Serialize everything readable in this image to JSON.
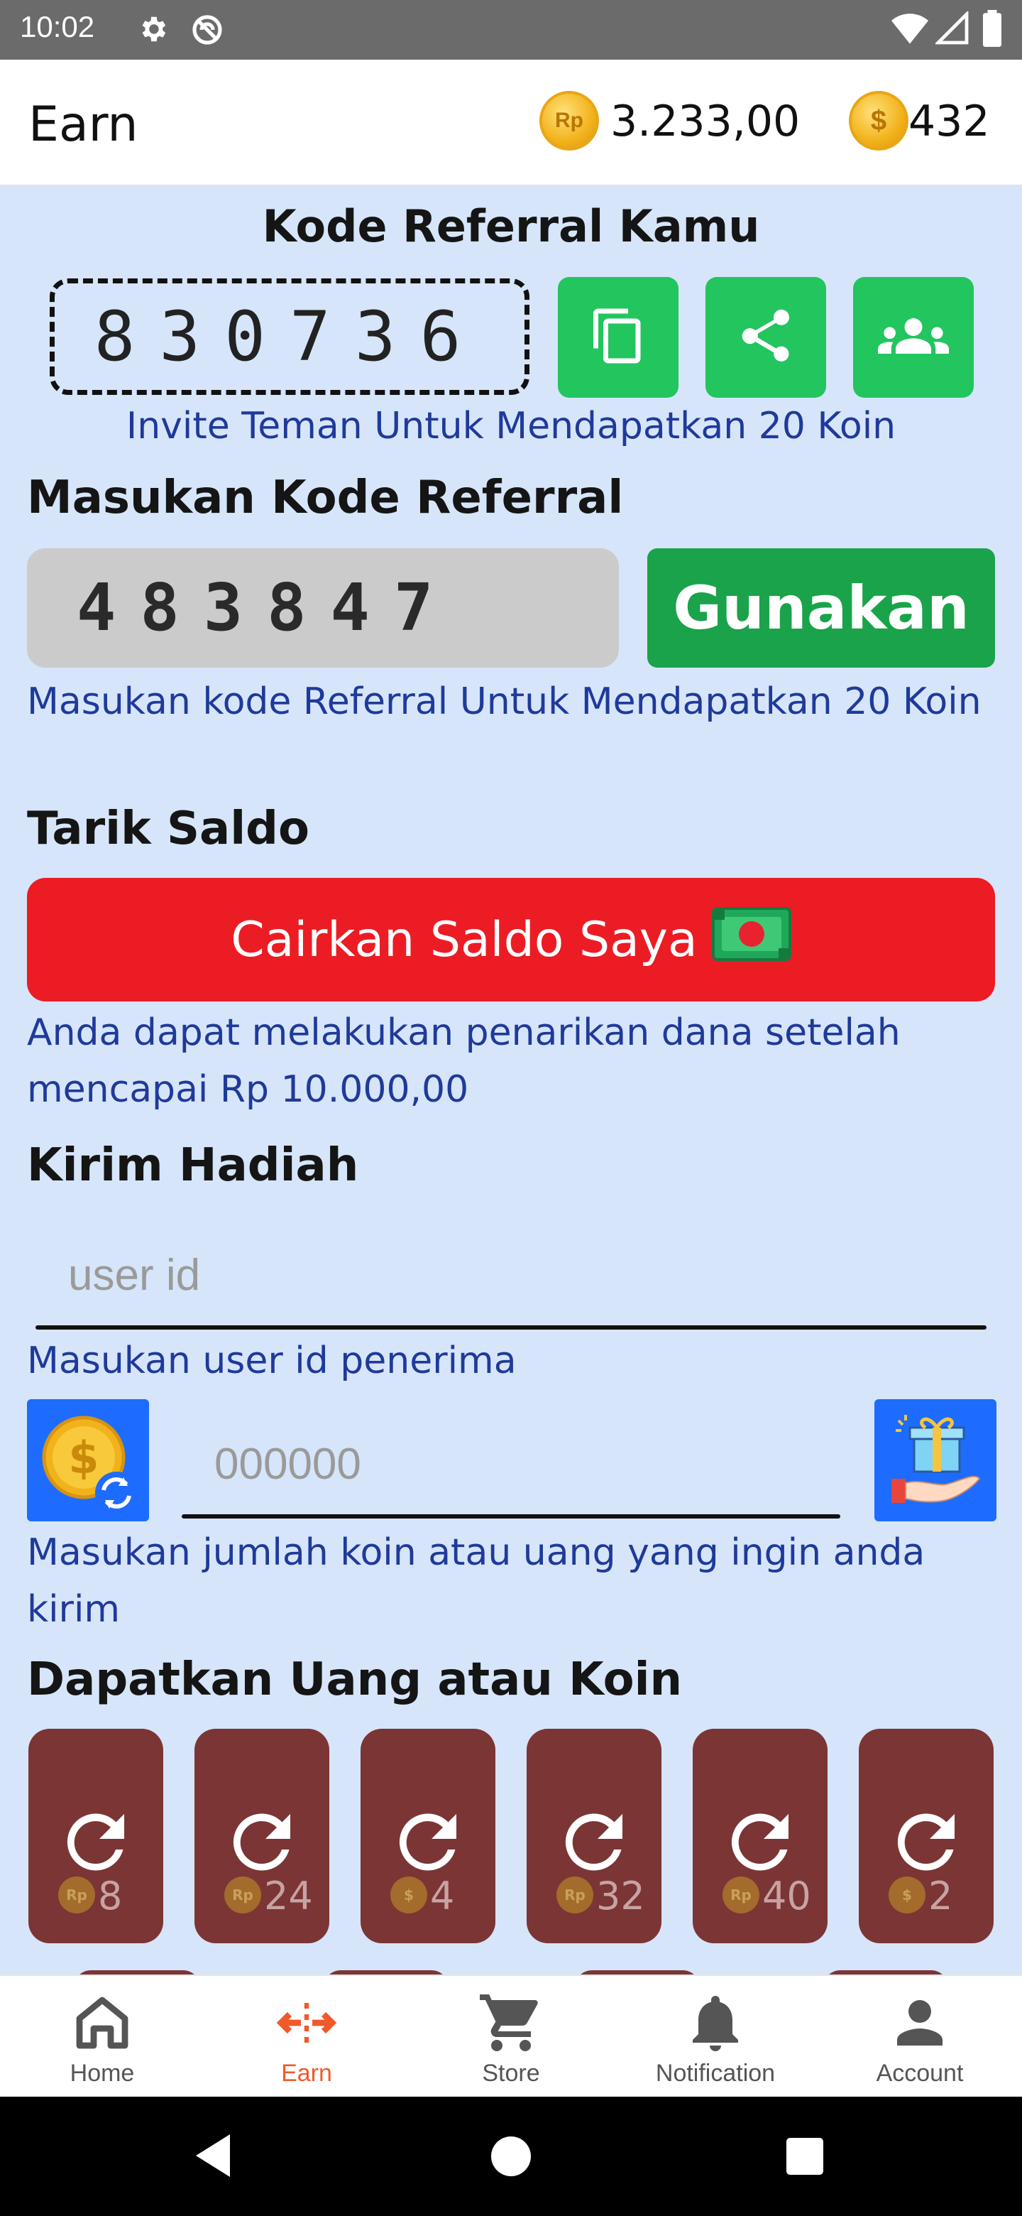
{
  "status_bar": {
    "time": "10:02"
  },
  "app_bar": {
    "title": "Earn",
    "rp_coin_label": "Rp",
    "money_balance": "3.233,00",
    "coin_label": "$",
    "coin_balance": "432"
  },
  "referral": {
    "heading": "Kode Referral Kamu",
    "my_code": "830736",
    "invite_hint": "Invite Teman Untuk Mendapatkan 20 Koin",
    "enter_heading": "Masukan Kode Referral",
    "entered_code": "483847",
    "use_button": "Gunakan",
    "enter_hint": "Masukan kode Referral Untuk Mendapatkan 20 Koin"
  },
  "withdraw": {
    "heading": "Tarik Saldo",
    "button": "Cairkan Saldo Saya",
    "hint": "Anda dapat melakukan penarikan dana setelah mencapai Rp 10.000,00"
  },
  "gift": {
    "heading": "Kirim Hadiah",
    "user_id_placeholder": "user id",
    "user_id_hint": "Masukan user id penerima",
    "amount_placeholder": "000000",
    "amount_hint": "Masukan jumlah koin atau uang yang ingin anda kirim"
  },
  "earn": {
    "heading": "Dapatkan Uang atau Koin",
    "tiles": [
      {
        "currency": "Rp",
        "value": "8"
      },
      {
        "currency": "Rp",
        "value": "24"
      },
      {
        "currency": "$",
        "value": "4"
      },
      {
        "currency": "Rp",
        "value": "32"
      },
      {
        "currency": "Rp",
        "value": "40"
      },
      {
        "currency": "$",
        "value": "2"
      }
    ]
  },
  "bottom_nav": {
    "items": [
      {
        "label": "Home",
        "icon": "home-icon"
      },
      {
        "label": "Earn",
        "icon": "earn-icon",
        "active": true
      },
      {
        "label": "Store",
        "icon": "cart-icon"
      },
      {
        "label": "Notification",
        "icon": "bell-icon"
      },
      {
        "label": "Account",
        "icon": "person-icon"
      }
    ]
  },
  "colors": {
    "background": "#d6e5fa",
    "green": "#22c55e",
    "red": "#ec1c24",
    "tile": "#7b3535",
    "hint_text": "#1f3a9a",
    "active_nav": "#f05a2b"
  }
}
